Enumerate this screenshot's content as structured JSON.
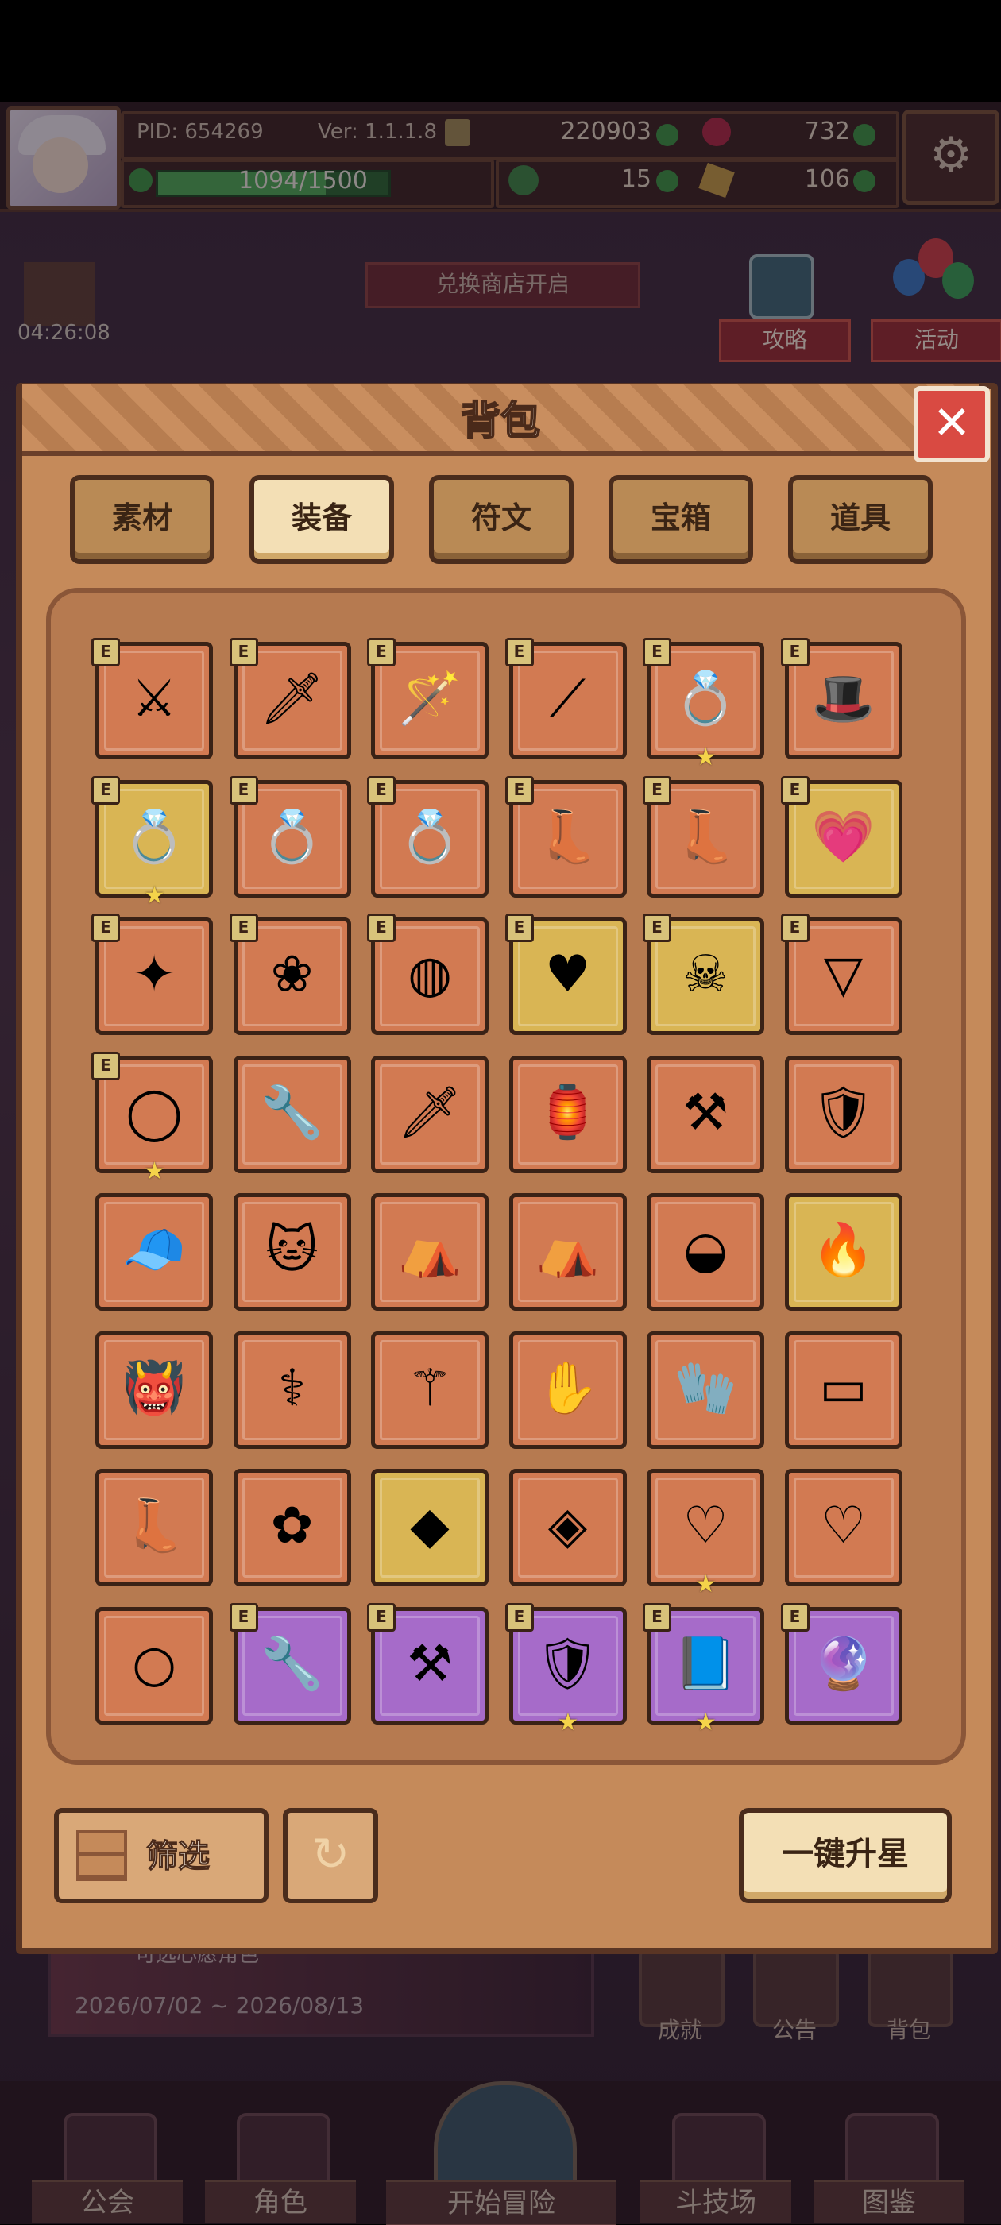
{
  "header": {
    "pid": "PID: 654269",
    "ver": "Ver: 1.1.1.8",
    "currency_gold": "220903",
    "currency_gem": "732",
    "currency_clover": "15",
    "currency_ticket": "106",
    "exp_text": "1094/1500",
    "exp_fraction": 0.729
  },
  "scene": {
    "timer": "04:26:08",
    "shop_banner": "兑换商店开启",
    "guide_label": "攻略",
    "event_label": "活动",
    "event_subtitle": "可选心愿角色",
    "event_date": "2026/07/02 ~ 2026/08/13",
    "side_buttons": [
      "成就",
      "公告",
      "背包"
    ]
  },
  "bag": {
    "title": "背包",
    "close_label": "✕",
    "tabs": [
      {
        "label": "素材",
        "active": false
      },
      {
        "label": "装备",
        "active": true
      },
      {
        "label": "符文",
        "active": false
      },
      {
        "label": "宝箱",
        "active": false
      },
      {
        "label": "道具",
        "active": false
      }
    ],
    "filter_label": "筛选",
    "reset_icon": "refresh-icon",
    "upgrade_label": "一键升星",
    "equip_badge": "E",
    "items": [
      {
        "icon": "crossed-swords-icon",
        "glyph": "⚔",
        "bg": "orange",
        "equipped": true,
        "star": false
      },
      {
        "icon": "flame-sword-icon",
        "glyph": "🗡",
        "bg": "orange",
        "equipped": true,
        "star": false
      },
      {
        "icon": "gem-staff-icon",
        "glyph": "🪄",
        "bg": "orange",
        "equipped": true,
        "star": false
      },
      {
        "icon": "spear-icon",
        "glyph": "⟋",
        "bg": "orange",
        "equipped": true,
        "star": false
      },
      {
        "icon": "gold-ring-icon",
        "glyph": "💍",
        "bg": "orange",
        "equipped": true,
        "star": true
      },
      {
        "icon": "feathered-helmet-icon",
        "glyph": "🎩",
        "bg": "orange",
        "equipped": true,
        "star": false
      },
      {
        "icon": "jeweled-ring-icon",
        "glyph": "💍",
        "bg": "gold",
        "equipped": true,
        "star": true
      },
      {
        "icon": "jade-ring-icon",
        "glyph": "💍",
        "bg": "orange",
        "equipped": true,
        "star": false
      },
      {
        "icon": "dark-ring-icon",
        "glyph": "💍",
        "bg": "orange",
        "equipped": true,
        "star": false
      },
      {
        "icon": "crimson-boots-icon",
        "glyph": "👢",
        "bg": "orange",
        "equipped": true,
        "star": false
      },
      {
        "icon": "green-boots-icon",
        "glyph": "👢",
        "bg": "orange",
        "equipped": true,
        "star": false
      },
      {
        "icon": "heart-shell-icon",
        "glyph": "💗",
        "bg": "gold",
        "equipped": true,
        "star": false
      },
      {
        "icon": "star-amulet-icon",
        "glyph": "✦",
        "bg": "orange",
        "equipped": true,
        "star": false
      },
      {
        "icon": "flower-eye-icon",
        "glyph": "❀",
        "bg": "orange",
        "equipped": true,
        "star": false
      },
      {
        "icon": "cyan-orb-icon",
        "glyph": "◍",
        "bg": "orange",
        "equipped": true,
        "star": false
      },
      {
        "icon": "heart-necklace-icon",
        "glyph": "♥",
        "bg": "gold",
        "equipped": true,
        "star": false
      },
      {
        "icon": "skull-necklace-icon",
        "glyph": "☠",
        "bg": "gold",
        "equipped": true,
        "star": false
      },
      {
        "icon": "pendant-necklace-icon",
        "glyph": "▽",
        "bg": "orange",
        "equipped": true,
        "star": false
      },
      {
        "icon": "jade-bangle-icon",
        "glyph": "◯",
        "bg": "orange",
        "equipped": true,
        "star": true
      },
      {
        "icon": "wrench-staff-icon",
        "glyph": "🔧",
        "bg": "orange",
        "equipped": false,
        "star": false
      },
      {
        "icon": "broad-sword-icon",
        "glyph": "🗡",
        "bg": "orange",
        "equipped": false,
        "star": false
      },
      {
        "icon": "lantern-armor-icon",
        "glyph": "🏮",
        "bg": "orange",
        "equipped": false,
        "star": false
      },
      {
        "icon": "iron-mace-icon",
        "glyph": "⚒",
        "bg": "orange",
        "equipped": false,
        "star": false
      },
      {
        "icon": "gold-shield-icon",
        "glyph": "🛡",
        "bg": "orange",
        "equipped": false,
        "star": false
      },
      {
        "icon": "pink-cap-icon",
        "glyph": "🧢",
        "bg": "orange",
        "equipped": false,
        "star": false
      },
      {
        "icon": "cat-hood-icon",
        "glyph": "🐱",
        "bg": "orange",
        "equipped": false,
        "star": false
      },
      {
        "icon": "green-hood-icon",
        "glyph": "⛺",
        "bg": "orange",
        "equipped": false,
        "star": false
      },
      {
        "icon": "leather-hood-icon",
        "glyph": "⛺",
        "bg": "orange",
        "equipped": false,
        "star": false
      },
      {
        "icon": "gold-ingot-icon",
        "glyph": "◒",
        "bg": "orange",
        "equipped": false,
        "star": false
      },
      {
        "icon": "flame-hat-icon",
        "glyph": "🔥",
        "bg": "gold",
        "equipped": false,
        "star": false
      },
      {
        "icon": "demon-armor-icon",
        "glyph": "👹",
        "bg": "orange",
        "equipped": false,
        "star": false
      },
      {
        "icon": "gem-scepter-icon",
        "glyph": "⚕",
        "bg": "orange",
        "equipped": false,
        "star": false
      },
      {
        "icon": "golden-trident-icon",
        "glyph": "⚚",
        "bg": "orange",
        "equipped": false,
        "star": false
      },
      {
        "icon": "silver-gauntlet-icon",
        "glyph": "✋",
        "bg": "orange",
        "equipped": false,
        "star": false
      },
      {
        "icon": "dark-glove-icon",
        "glyph": "🧤",
        "bg": "orange",
        "equipped": false,
        "star": false
      },
      {
        "icon": "blue-bracer-icon",
        "glyph": "▭",
        "bg": "orange",
        "equipped": false,
        "star": false
      },
      {
        "icon": "purple-boots-icon",
        "glyph": "👢",
        "bg": "orange",
        "equipped": false,
        "star": false
      },
      {
        "icon": "lilac-flower-icon",
        "glyph": "✿",
        "bg": "orange",
        "equipped": false,
        "star": false
      },
      {
        "icon": "cyan-crystal-icon",
        "glyph": "◆",
        "bg": "gold",
        "equipped": false,
        "star": false
      },
      {
        "icon": "olive-crystal-icon",
        "glyph": "◈",
        "bg": "orange",
        "equipped": false,
        "star": false
      },
      {
        "icon": "gold-necklace-icon",
        "glyph": "♡",
        "bg": "orange",
        "equipped": false,
        "star": true
      },
      {
        "icon": "jewel-necklace-icon",
        "glyph": "♡",
        "bg": "orange",
        "equipped": false,
        "star": false
      },
      {
        "icon": "bead-ring-icon",
        "glyph": "○",
        "bg": "orange",
        "equipped": false,
        "star": false
      },
      {
        "icon": "wrench-key-icon",
        "glyph": "🔧",
        "bg": "purple",
        "equipped": true,
        "star": false
      },
      {
        "icon": "silver-mace-icon",
        "glyph": "⚒",
        "bg": "purple",
        "equipped": true,
        "star": false
      },
      {
        "icon": "cross-shield-icon",
        "glyph": "🛡",
        "bg": "purple",
        "equipped": true,
        "star": true
      },
      {
        "icon": "teal-tome-icon",
        "glyph": "📘",
        "bg": "purple",
        "equipped": true,
        "star": true
      },
      {
        "icon": "violet-orb-icon",
        "glyph": "🔮",
        "bg": "purple",
        "equipped": true,
        "star": false
      }
    ]
  },
  "nav": [
    "公会",
    "角色",
    "开始冒险",
    "斗技场",
    "图鉴"
  ],
  "colors": {
    "cell_orange": "#d27a52",
    "cell_gold": "#d9b554",
    "cell_purple": "#a66bc9",
    "star": "#f4d34a"
  }
}
